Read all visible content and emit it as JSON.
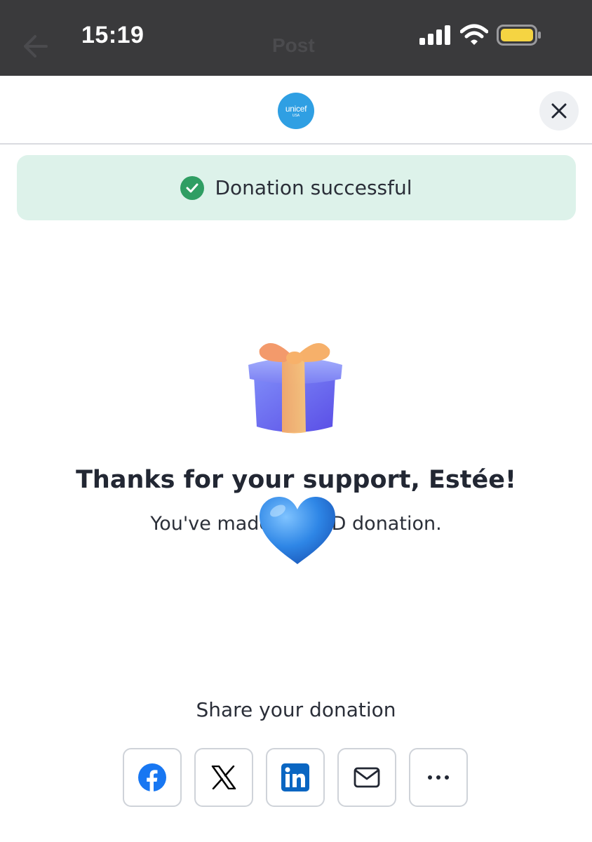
{
  "status_bar": {
    "time": "15:19",
    "ghost_title": "Post",
    "icons": [
      "cellular-signal-icon",
      "wifi-icon",
      "battery-icon"
    ],
    "battery_color": "#f5d442"
  },
  "header": {
    "logo_text": "unicef",
    "logo_subtext": "USA",
    "logo_color": "#2f9fe3",
    "close_icon": "close-icon"
  },
  "banner": {
    "text": "Donation successful",
    "icon": "check-circle-icon",
    "background": "#ddf2ea",
    "accent": "#2f9e63"
  },
  "confirmation": {
    "gift_icon": "gift-box-icon",
    "title": "Thanks for your support, Estée!",
    "subtitle_before": "You've made a",
    "subtitle_after": "USD donation.",
    "overlay_icon": "blue-heart-emoji-icon"
  },
  "share": {
    "title": "Share your donation",
    "buttons": [
      {
        "icon": "facebook-icon",
        "color": "#1877f2"
      },
      {
        "icon": "x-icon",
        "color": "#000000"
      },
      {
        "icon": "linkedin-icon",
        "color": "#0a66c2"
      },
      {
        "icon": "mail-icon",
        "color": "#222733"
      },
      {
        "icon": "more-horizontal-icon",
        "color": "#222733"
      }
    ]
  }
}
